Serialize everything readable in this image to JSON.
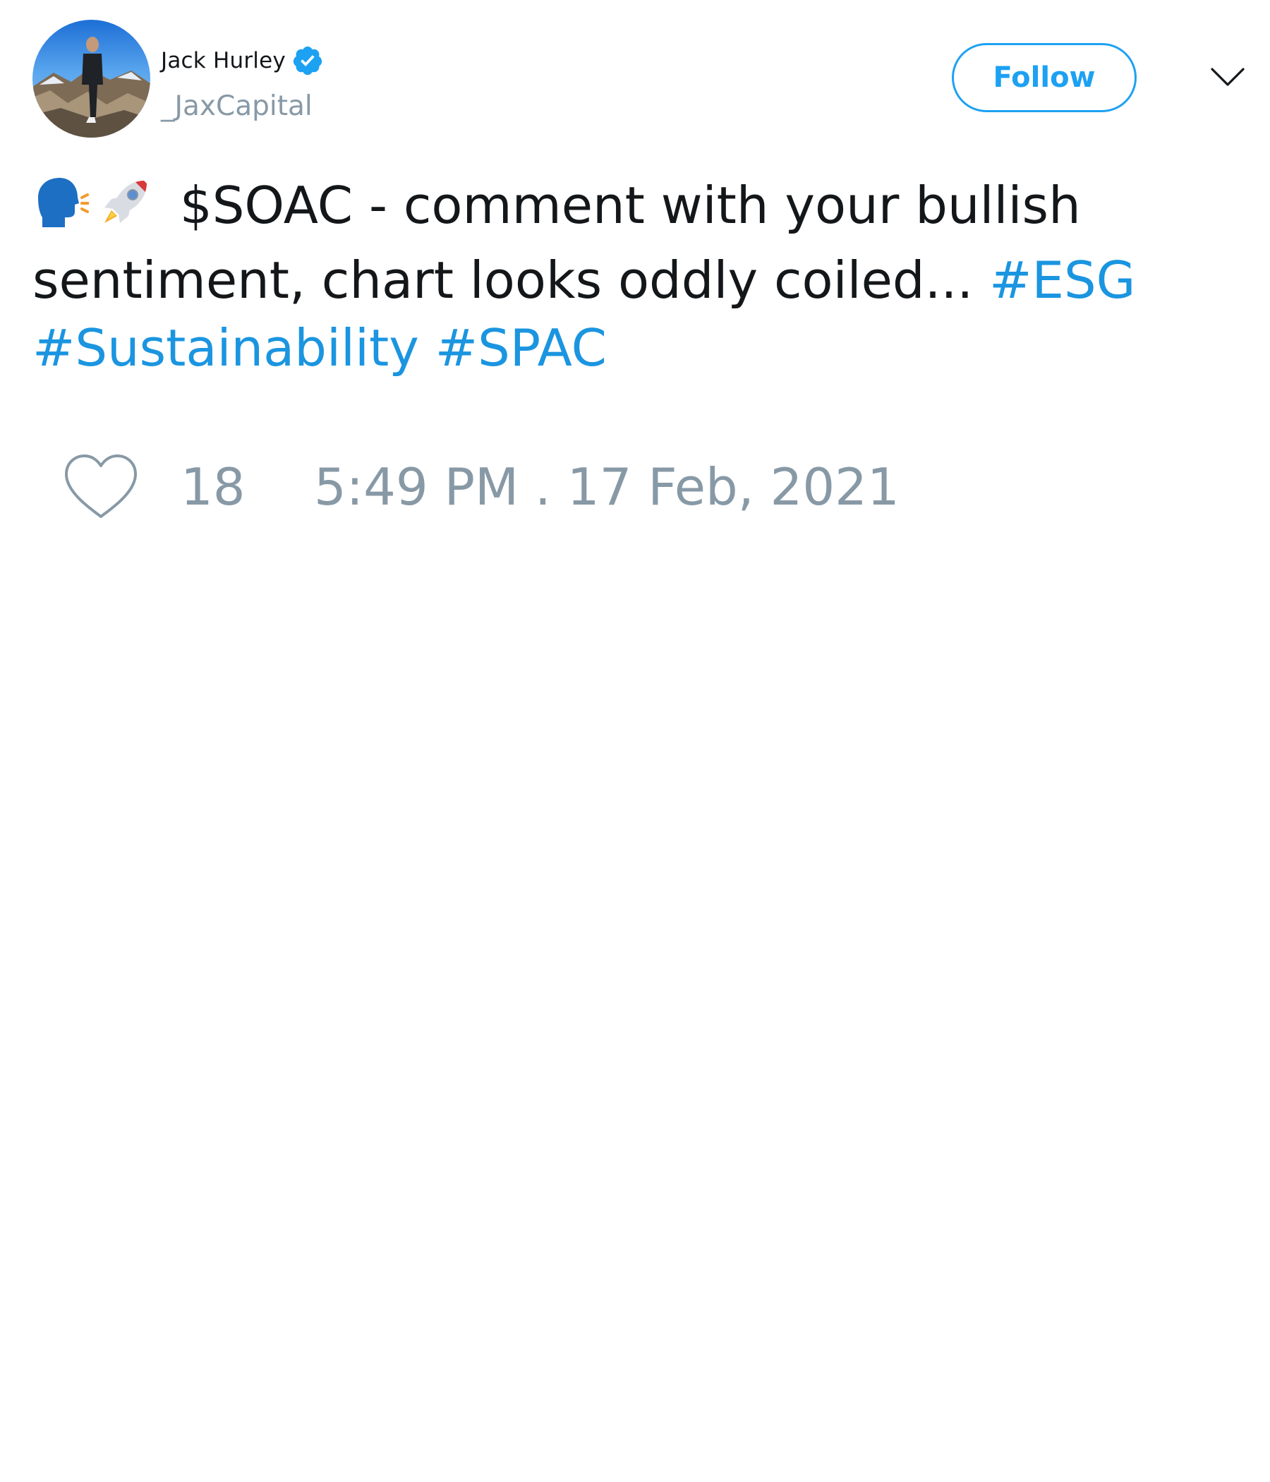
{
  "author": {
    "display_name": "Jack Hurley",
    "handle": "_JaxCapital",
    "verified": true,
    "avatar_icon": "profile-photo"
  },
  "header": {
    "follow_label": "Follow",
    "menu_icon": "chevron-down-icon"
  },
  "tweet": {
    "emojis": [
      "speaking-head-icon",
      "rocket-icon"
    ],
    "text_line1": "$SOAC - comment with your bullish",
    "text_line2": "sentiment, chart looks oddly coiled...",
    "hashtags": [
      "#ESG",
      "#Sustainability",
      "#SPAC"
    ]
  },
  "footer": {
    "like_icon": "heart-icon",
    "like_count": "18",
    "timestamp": "5:49 PM . 17 Feb, 2021"
  },
  "colors": {
    "accent": "#1da1f2",
    "hashtag": "#1b95e0",
    "muted": "#8899a6",
    "text": "#14171a"
  }
}
